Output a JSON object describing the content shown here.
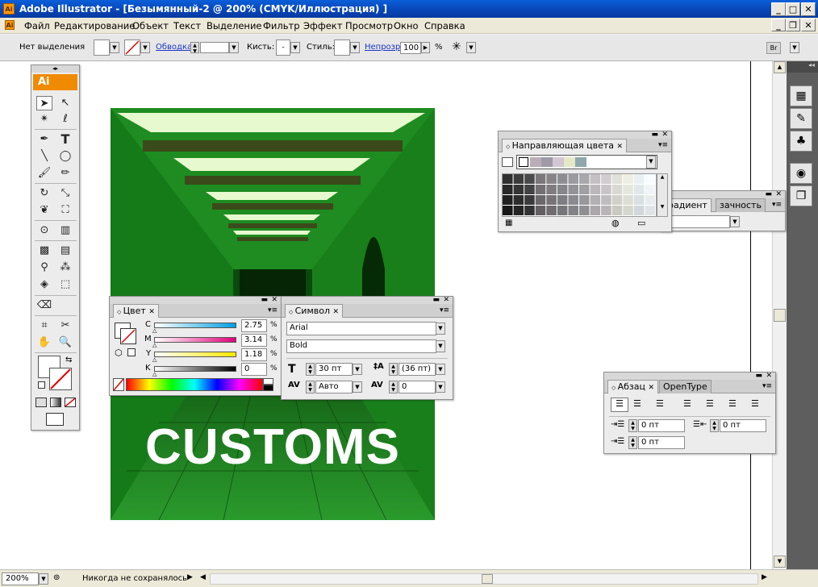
{
  "window": {
    "title": "Adobe Illustrator - [Безымянный-2 @ 200% (CMYK/Иллюстрация) ]",
    "logo": "Ai"
  },
  "menu": [
    "Файл",
    "Редактирование",
    "Объект",
    "Текст",
    "Выделение",
    "Фильтр",
    "Эффект",
    "Просмотр",
    "Окно",
    "Справка"
  ],
  "control": {
    "selection": "Нет выделения",
    "stroke_label": "Обводка:",
    "brush_label": "Кисть:",
    "style_label": "Стиль:",
    "opacity_label": "Непрозр.:",
    "opacity_value": "100",
    "percent": "%"
  },
  "toolbox": {
    "logo": "Ai"
  },
  "artwork": {
    "text": "CUSTOMS"
  },
  "color_panel": {
    "tab": "Цвет",
    "channels": [
      {
        "label": "C",
        "value": "2.75",
        "color": "#00a0e0"
      },
      {
        "label": "M",
        "value": "3.14",
        "color": "#e0007a"
      },
      {
        "label": "Y",
        "value": "1.18",
        "color": "#ffe800"
      },
      {
        "label": "K",
        "value": "0",
        "color": "#000000"
      }
    ],
    "percent": "%"
  },
  "symbol_panel": {
    "tab": "Символ",
    "font": "Arial",
    "style": "Bold",
    "size": "30 пт",
    "leading": "(36 пт)",
    "kerning": "Авто",
    "tracking": "0"
  },
  "guide_panel": {
    "tab": "Направляющая цвета"
  },
  "gradient_panel": {
    "tab1": "радиент",
    "tab2": "зачность"
  },
  "paragraph_panel": {
    "tab1": "Абзац",
    "tab2": "OpenType",
    "left_indent": "0 пт",
    "right_indent": "0 пт",
    "first_indent": "0 пт"
  },
  "status": {
    "zoom": "200%",
    "status_text": "Никогда не сохранялось"
  }
}
